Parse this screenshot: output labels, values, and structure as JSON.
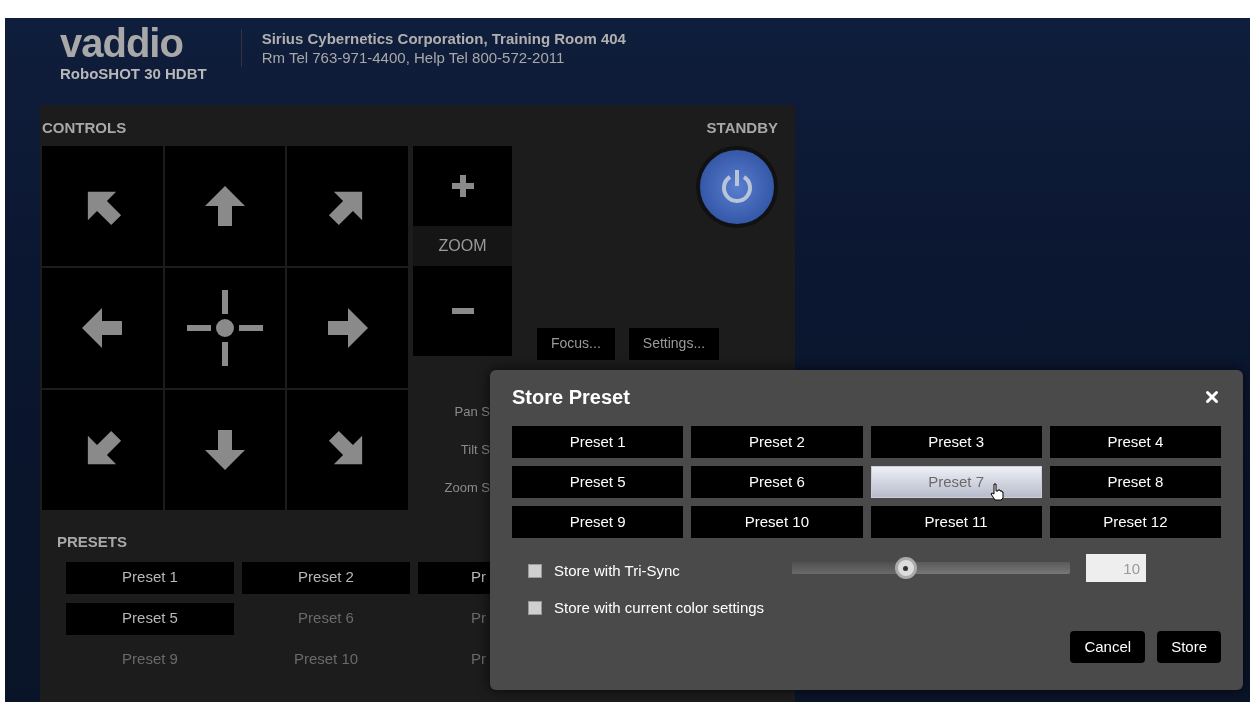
{
  "header": {
    "logo": "vaddio",
    "model": "RoboSHOT 30 HDBT",
    "location": "Sirius Cybernetics Corporation, Training Room 404",
    "phones": "Rm Tel 763-971-4400, Help Tel 800-572-2011"
  },
  "controls": {
    "title": "CONTROLS",
    "standby_label": "STANDBY",
    "zoom_label": "ZOOM",
    "buttons": [
      "Focus...",
      "Settings..."
    ],
    "speed_labels": [
      "Pan S",
      "Tilt S",
      "Zoom S"
    ]
  },
  "presets": {
    "title": "PRESETS",
    "items": [
      {
        "label": "Preset 1",
        "stored": true
      },
      {
        "label": "Preset 2",
        "stored": true
      },
      {
        "label": "Pr",
        "stored": true
      },
      {
        "label": "Preset 5",
        "stored": true
      },
      {
        "label": "Preset 6",
        "stored": false
      },
      {
        "label": "Pr",
        "stored": false
      },
      {
        "label": "Preset 9",
        "stored": false
      },
      {
        "label": "Preset 10",
        "stored": false
      },
      {
        "label": "Pr",
        "stored": false
      }
    ]
  },
  "dialog": {
    "title": "Store Preset",
    "presets": [
      {
        "label": "Preset 1",
        "selected": false
      },
      {
        "label": "Preset 2",
        "selected": false
      },
      {
        "label": "Preset 3",
        "selected": false
      },
      {
        "label": "Preset 4",
        "selected": false
      },
      {
        "label": "Preset 5",
        "selected": false
      },
      {
        "label": "Preset 6",
        "selected": false
      },
      {
        "label": "Preset 7",
        "selected": true
      },
      {
        "label": "Preset 8",
        "selected": false
      },
      {
        "label": "Preset 9",
        "selected": false
      },
      {
        "label": "Preset 10",
        "selected": false
      },
      {
        "label": "Preset 11",
        "selected": false
      },
      {
        "label": "Preset 12",
        "selected": false
      }
    ],
    "options": [
      {
        "label": "Store with Tri-Sync",
        "checked": false
      },
      {
        "label": "Store with current color settings",
        "checked": false
      }
    ],
    "slider": {
      "level": 0.41
    },
    "value": "10",
    "buttons": [
      "Cancel",
      "Store"
    ]
  }
}
